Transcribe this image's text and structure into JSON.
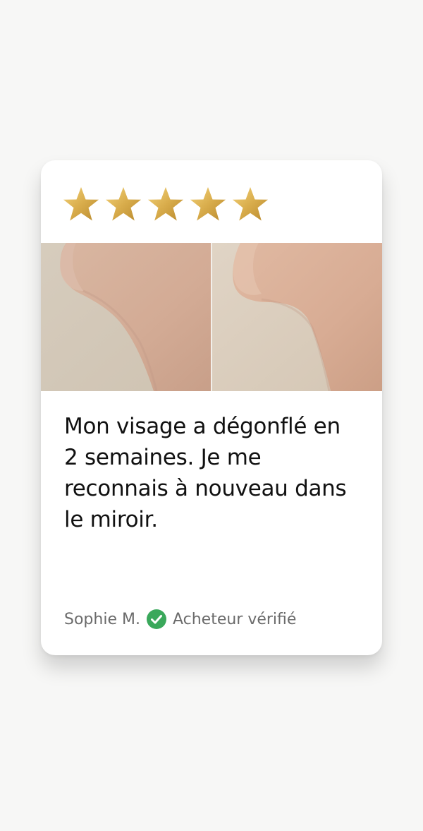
{
  "review": {
    "rating": 5,
    "rating_max": 5,
    "star_color": "#d9ad4c",
    "quote": "Mon visage a dégonflé en 2 semaines. Je me reconnais à nouveau dans le miroir.",
    "author": "Sophie M.",
    "verified_icon": "check-circle-icon",
    "verified_color": "#3aa85b",
    "verified_label": "Acheteur vérifié"
  }
}
